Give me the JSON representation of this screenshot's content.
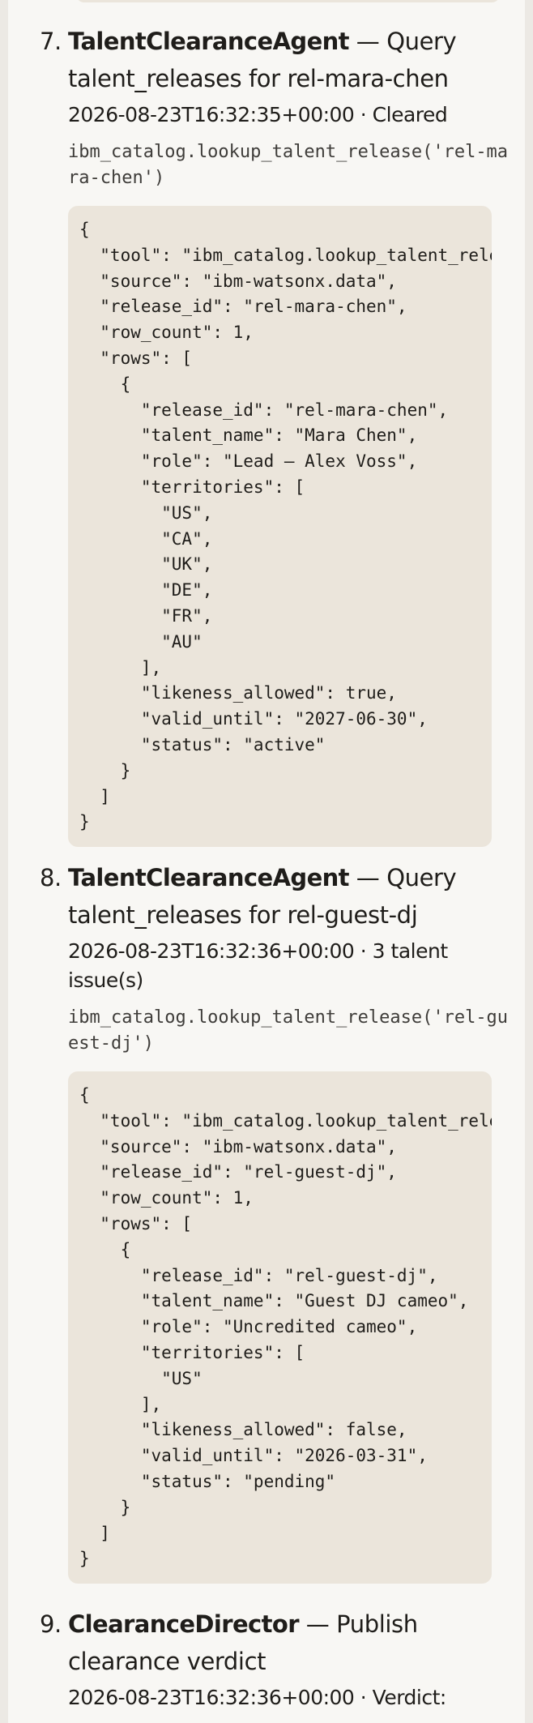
{
  "entries": [
    {
      "number": "7.",
      "agent": "TalentClearanceAgent",
      "action": " — Query talent_releases for rel-mara-chen",
      "meta": "2026-08-23T16:32:35+00:00 · Cleared",
      "call": "ibm_catalog.lookup_talent_release('rel-mara-chen')",
      "json": "{\n  \"tool\": \"ibm_catalog.lookup_talent_release\",\n  \"source\": \"ibm-watsonx.data\",\n  \"release_id\": \"rel-mara-chen\",\n  \"row_count\": 1,\n  \"rows\": [\n    {\n      \"release_id\": \"rel-mara-chen\",\n      \"talent_name\": \"Mara Chen\",\n      \"role\": \"Lead — Alex Voss\",\n      \"territories\": [\n        \"US\",\n        \"CA\",\n        \"UK\",\n        \"DE\",\n        \"FR\",\n        \"AU\"\n      ],\n      \"likeness_allowed\": true,\n      \"valid_until\": \"2027-06-30\",\n      \"status\": \"active\"\n    }\n  ]\n}"
    },
    {
      "number": "8.",
      "agent": "TalentClearanceAgent",
      "action": " — Query talent_releases for rel-guest-dj",
      "meta": "2026-08-23T16:32:36+00:00 · 3 talent issue(s)",
      "call": "ibm_catalog.lookup_talent_release('rel-guest-dj')",
      "json": "{\n  \"tool\": \"ibm_catalog.lookup_talent_release\",\n  \"source\": \"ibm-watsonx.data\",\n  \"release_id\": \"rel-guest-dj\",\n  \"row_count\": 1,\n  \"rows\": [\n    {\n      \"release_id\": \"rel-guest-dj\",\n      \"talent_name\": \"Guest DJ cameo\",\n      \"role\": \"Uncredited cameo\",\n      \"territories\": [\n        \"US\"\n      ],\n      \"likeness_allowed\": false,\n      \"valid_until\": \"2026-03-31\",\n      \"status\": \"pending\"\n    }\n  ]\n}"
    },
    {
      "number": "9.",
      "agent": "ClearanceDirector",
      "action": " — Publish clearance verdict",
      "meta": "2026-08-23T16:32:36+00:00 · Verdict:"
    }
  ]
}
